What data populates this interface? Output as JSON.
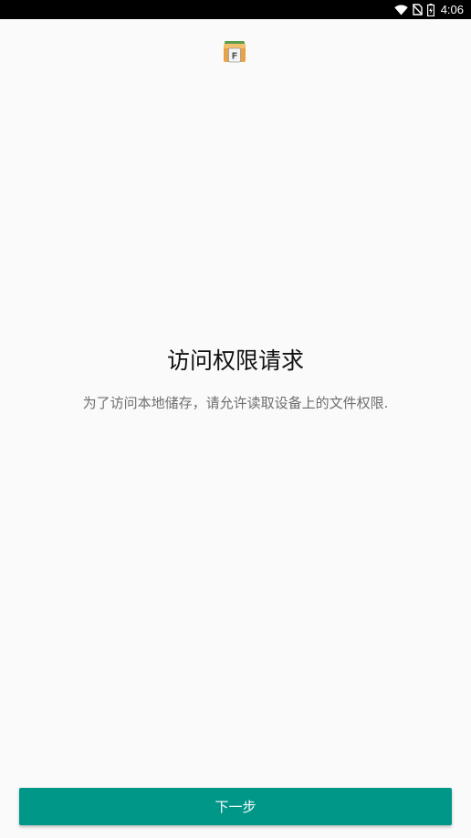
{
  "status_bar": {
    "time": "4:06",
    "icons": [
      "wifi-icon",
      "no-sim-icon",
      "battery-charging-icon"
    ]
  },
  "app": {
    "logo_icon": "file-manager-logo-icon",
    "logo_letter": "F"
  },
  "main": {
    "title": "访问权限请求",
    "subtitle": "为了访问本地储存，请允许读取设备上的文件权限."
  },
  "footer": {
    "next_label": "下一步"
  },
  "colors": {
    "accent": "#009688",
    "background": "#fafafa",
    "status_bar": "#000000"
  }
}
